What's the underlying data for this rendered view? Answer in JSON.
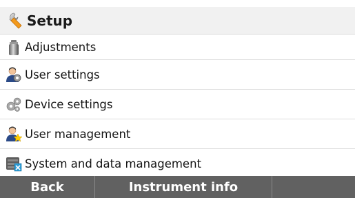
{
  "header": {
    "title": "Setup",
    "icon": "wrench-icon"
  },
  "menu": {
    "items": [
      {
        "label": "Adjustments",
        "icon": "weight-icon"
      },
      {
        "label": "User settings",
        "icon": "user-settings-icon"
      },
      {
        "label": "Device settings",
        "icon": "gears-icon"
      },
      {
        "label": "User management",
        "icon": "user-management-icon"
      },
      {
        "label": "System and data management",
        "icon": "database-icon"
      }
    ]
  },
  "softkeys": {
    "back": "Back",
    "instrument_info": "Instrument info",
    "third": ""
  },
  "colors": {
    "footer_bg": "#616161",
    "header_bg": "#f1f1f1",
    "accent_orange": "#f39a1c"
  }
}
